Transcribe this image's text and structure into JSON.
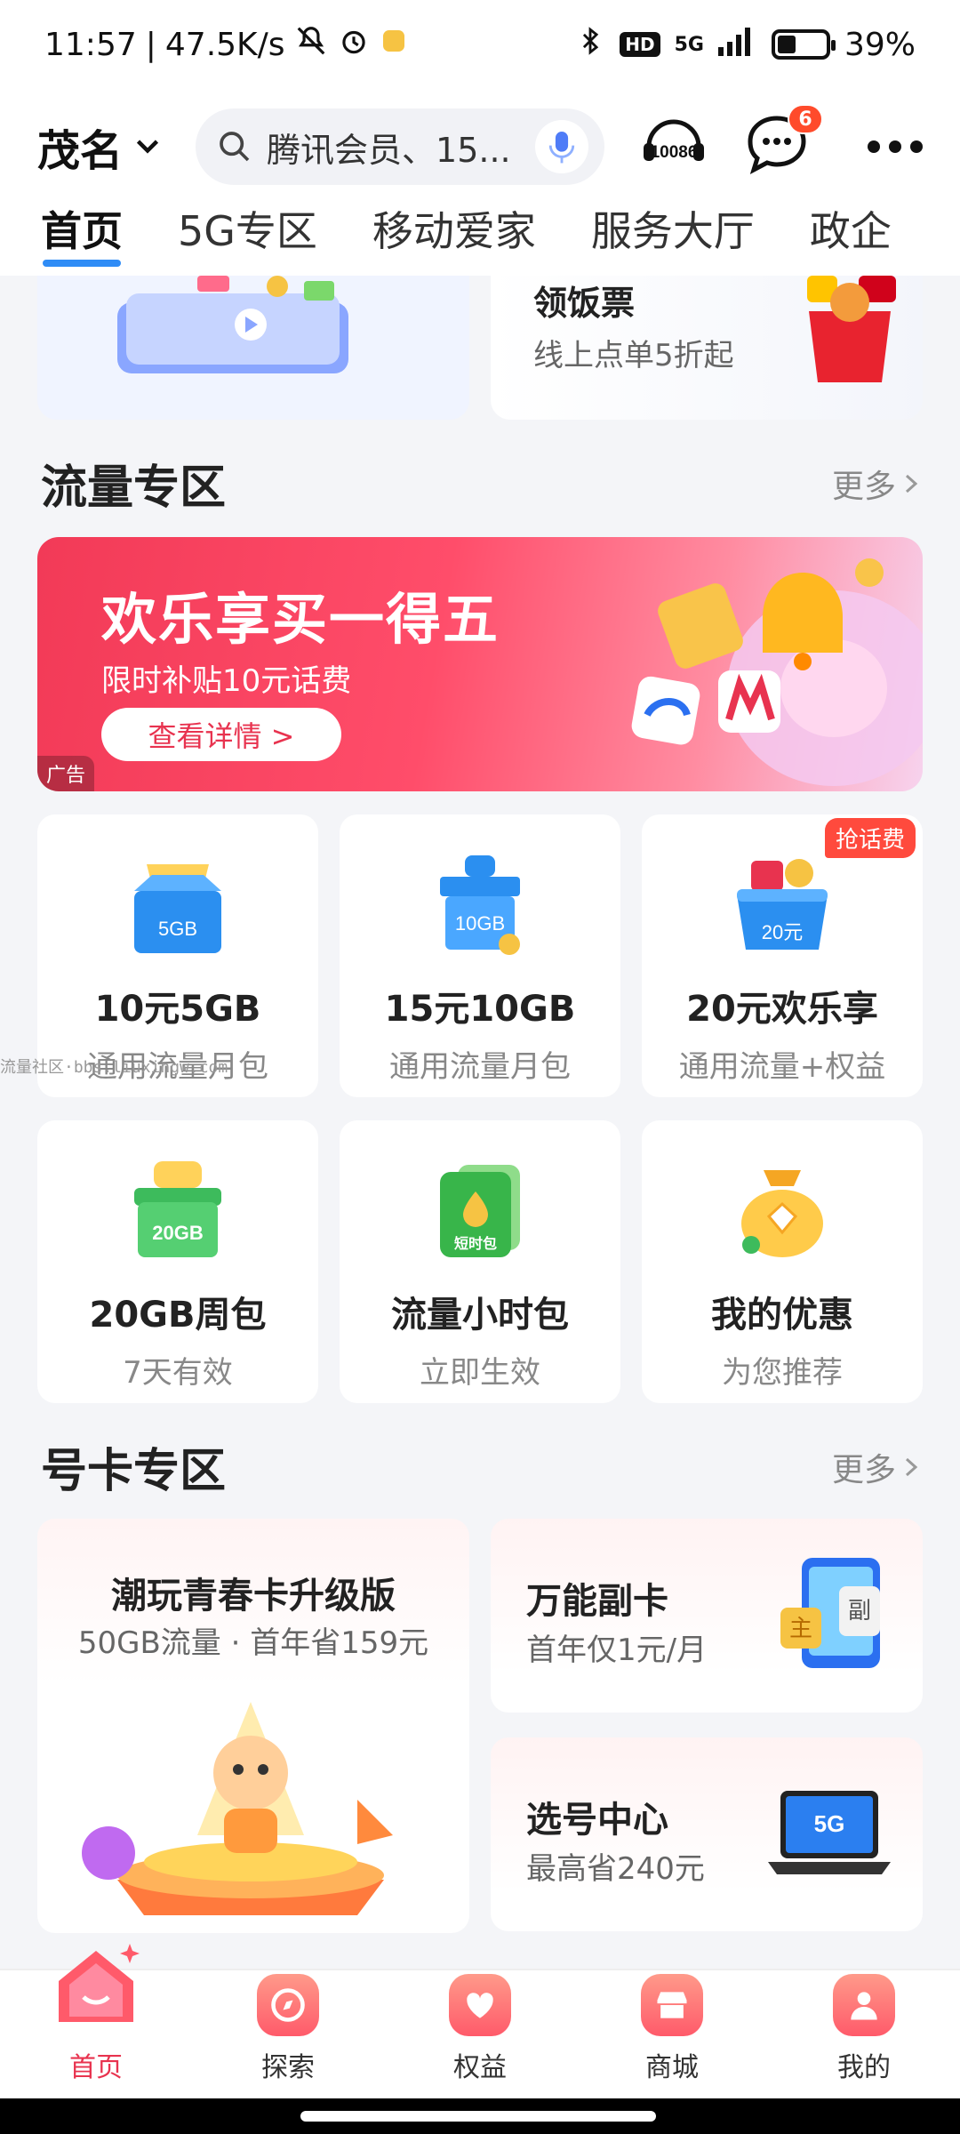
{
  "status_bar": {
    "time": "11:57",
    "net_speed": "47.5K/s",
    "network": "5G",
    "battery": "39%",
    "battery_level": 0.39
  },
  "header": {
    "city": "茂名",
    "search_placeholder": "腾讯会员、15...",
    "service_icon_label": "10086",
    "message_count": "6"
  },
  "tabs": [
    {
      "label": "首页",
      "active": true
    },
    {
      "label": "5G专区"
    },
    {
      "label": "移动爱家"
    },
    {
      "label": "服务大厅"
    },
    {
      "label": "政企"
    }
  ],
  "top_promo": {
    "title": "领饭票",
    "subtitle": "线上点单5折起"
  },
  "traffic_section": {
    "title": "流量专区",
    "more": "更多",
    "banner": {
      "title": "欢乐享买一得五",
      "subtitle": "限时补贴10元话费",
      "button": "查看详情 >",
      "ad_tag": "广告"
    },
    "products": [
      {
        "title": "10元5GB",
        "subtitle": "通用流量月包",
        "icon_label": "5GB"
      },
      {
        "title": "15元10GB",
        "subtitle": "通用流量月包",
        "icon_label": "10GB"
      },
      {
        "title": "20元欢乐享",
        "subtitle": "通用流量+权益",
        "icon_label": "20元",
        "tag": "抢话费"
      },
      {
        "title": "20GB周包",
        "subtitle": "7天有效",
        "icon_label": "20GB"
      },
      {
        "title": "流量小时包",
        "subtitle": "立即生效",
        "icon_label": "短时包"
      },
      {
        "title": "我的优惠",
        "subtitle": "为您推荐"
      }
    ]
  },
  "card_section": {
    "title": "号卡专区",
    "more": "更多",
    "main_card": {
      "title": "潮玩青春卡升级版",
      "subtitle": "50GB流量 · 首年省159元"
    },
    "side_cards": [
      {
        "title": "万能副卡",
        "subtitle": "首年仅1元/月",
        "icon_main": "主",
        "icon_sub": "副"
      },
      {
        "title": "选号中心",
        "subtitle": "最高省240元",
        "icon_label": "5G"
      }
    ]
  },
  "watermark": "流量社区·bbs.liuxingw.com",
  "bottom_nav": [
    {
      "label": "首页",
      "active": true
    },
    {
      "label": "探索"
    },
    {
      "label": "权益"
    },
    {
      "label": "商城"
    },
    {
      "label": "我的"
    }
  ]
}
